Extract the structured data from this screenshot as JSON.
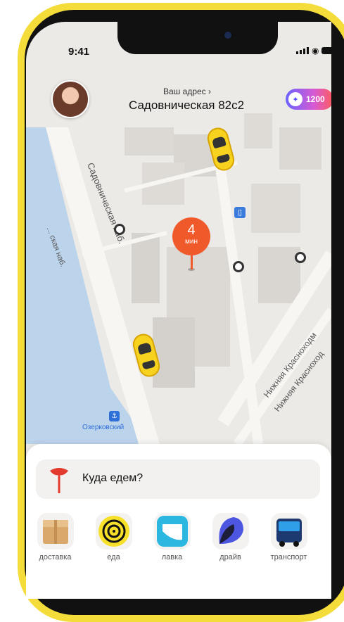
{
  "status_bar": {
    "time": "9:41"
  },
  "header": {
    "address_caption": "Ваш адрес ›",
    "address": "Садовническая 82с2",
    "points": "1200"
  },
  "map": {
    "eta_value": "4",
    "eta_unit": "мин",
    "streets": {
      "embankment": "Садовническая наб.",
      "left_street": "... ская наб.",
      "lower_1": "Нижняя Красноходм",
      "lower_2": "Нижняя Красноход"
    },
    "pier_label": "Озерковский"
  },
  "sheet": {
    "search_label": "Куда едем?",
    "services": [
      {
        "label": "доставка",
        "icon": "box-icon"
      },
      {
        "label": "еда",
        "icon": "spiral-icon"
      },
      {
        "label": "лавка",
        "icon": "lavka-icon"
      },
      {
        "label": "драйв",
        "icon": "drive-icon"
      },
      {
        "label": "транспорт",
        "icon": "bus-icon"
      }
    ]
  },
  "colors": {
    "phone_frame": "#f4dd3b",
    "pin": "#f05a2a",
    "river": "#bcd3ec"
  }
}
